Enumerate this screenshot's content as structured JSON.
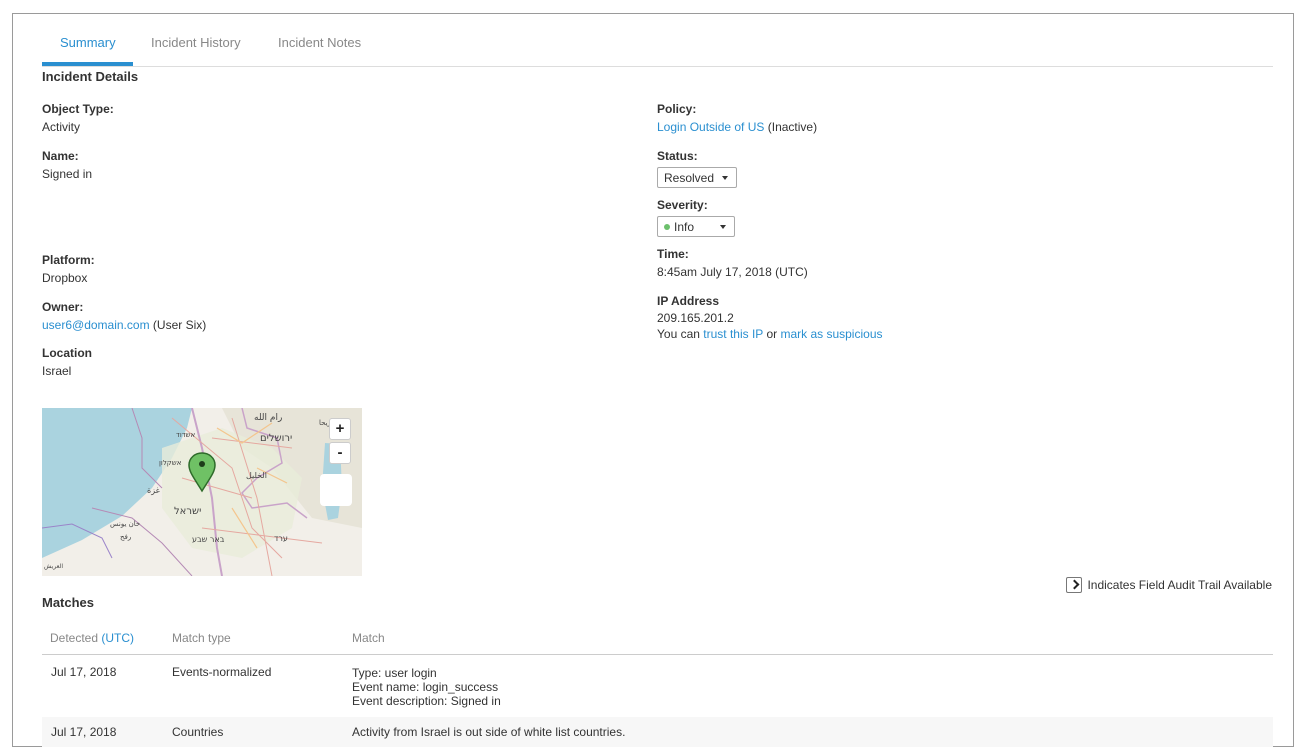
{
  "tabs": {
    "summary": "Summary",
    "history": "Incident History",
    "notes": "Incident Notes"
  },
  "details": {
    "title": "Incident Details",
    "object_type_label": "Object Type:",
    "object_type_value": "Activity",
    "name_label": "Name:",
    "name_value": "Signed in",
    "platform_label": "Platform:",
    "platform_value": "Dropbox",
    "owner_label": "Owner:",
    "owner_email": "user6@domain.com",
    "owner_name": "(User Six)",
    "location_label": "Location",
    "location_value": "Israel",
    "policy_label": "Policy:",
    "policy_link": "Login Outside of US",
    "policy_state": "(Inactive)",
    "status_label": "Status:",
    "status_value": "Resolved",
    "severity_label": "Severity:",
    "severity_value": "Info",
    "severity_color": "#6cc06c",
    "time_label": "Time:",
    "time_value": "8:45am July 17, 2018 (UTC)",
    "ip_label": "IP Address",
    "ip_value": "209.165.201.2",
    "ip_prefix": "You can",
    "trust_link": "trust this IP",
    "ip_or": "or",
    "suspicious_link": "mark as suspicious"
  },
  "map": {
    "zoom_in": "+",
    "zoom_out": "-",
    "marker_icon": "map-pin-icon",
    "labels": [
      "رام الله",
      "أريحا",
      "ירושלים",
      "אשדוד",
      "אשקלון",
      "غزة",
      "الخليل",
      "ישראל",
      "خان يونس",
      "رفح",
      "באר שבע",
      "ערד",
      "العريش"
    ]
  },
  "audit": {
    "text": "Indicates Field Audit Trail Available",
    "icon": "chevron-right-icon"
  },
  "matches": {
    "title": "Matches",
    "col_detected": "Detected",
    "col_detected_tz": "(UTC)",
    "col_type": "Match type",
    "col_match": "Match",
    "rows": [
      {
        "detected": "Jul 17, 2018",
        "type": "Events-normalized",
        "match_lines": [
          "Type: user login",
          "Event name: login_success",
          "Event description: Signed in"
        ]
      },
      {
        "detected": "Jul 17, 2018",
        "type": "Countries",
        "match_lines": [
          "Activity from Israel is out side of white list countries."
        ]
      }
    ]
  },
  "colors": {
    "accent": "#2a8fd0",
    "marker": "#6fc165",
    "water": "#aad3df",
    "land": "#f2efe9"
  }
}
